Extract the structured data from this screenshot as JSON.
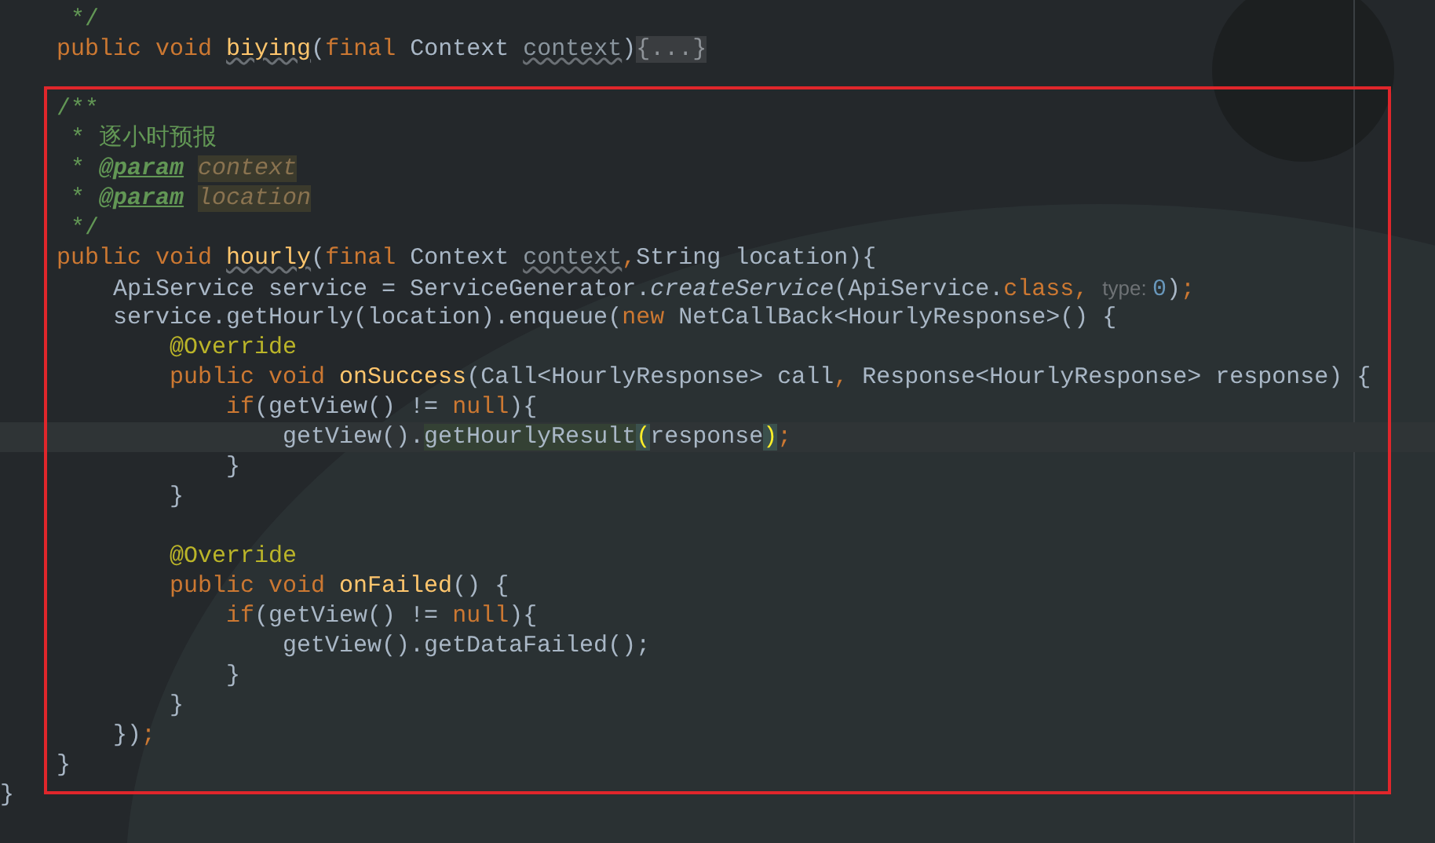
{
  "editor": {
    "lines": [
      {
        "tokens": [
          {
            "kind": "comment",
            "text": "     */"
          }
        ]
      },
      {
        "tokens": [
          {
            "kind": "keyword",
            "text": "    public void "
          },
          {
            "kind": "method",
            "text": "biying",
            "warn": true
          },
          {
            "kind": "plain",
            "text": "("
          },
          {
            "kind": "keyword",
            "text": "final "
          },
          {
            "kind": "plain",
            "text": "Context "
          },
          {
            "kind": "unused",
            "text": "context",
            "warn": true
          },
          {
            "kind": "plain",
            "text": ")"
          },
          {
            "kind": "fold",
            "text": "{...}"
          }
        ]
      },
      {
        "space_before": true,
        "tokens": [
          {
            "kind": "comment",
            "text": "    /**"
          }
        ]
      },
      {
        "tokens": [
          {
            "kind": "comment",
            "text": "     * 逐小时预报"
          }
        ]
      },
      {
        "tokens": [
          {
            "kind": "comment",
            "text": "     * "
          },
          {
            "kind": "doctag",
            "text": "@param "
          },
          {
            "kind": "docref",
            "text": "context"
          }
        ]
      },
      {
        "tokens": [
          {
            "kind": "comment",
            "text": "     * "
          },
          {
            "kind": "doctag",
            "text": "@param "
          },
          {
            "kind": "docref",
            "text": "location"
          }
        ]
      },
      {
        "tokens": [
          {
            "kind": "comment",
            "text": "     */"
          }
        ]
      },
      {
        "tokens": [
          {
            "kind": "keyword",
            "text": "    public void "
          },
          {
            "kind": "method",
            "text": "hourly",
            "warn": true
          },
          {
            "kind": "plain",
            "text": "("
          },
          {
            "kind": "keyword",
            "text": "final "
          },
          {
            "kind": "plain",
            "text": "Context "
          },
          {
            "kind": "unused",
            "text": "context",
            "warn": true
          },
          {
            "kind": "keyword",
            "text": ","
          },
          {
            "kind": "plain",
            "text": "String location){"
          }
        ]
      },
      {
        "tokens": [
          {
            "kind": "plain",
            "text": "        ApiService service = ServiceGenerator."
          },
          {
            "kind": "static",
            "text": "createService"
          },
          {
            "kind": "plain",
            "text": "(ApiService."
          },
          {
            "kind": "keyword",
            "text": "class, "
          },
          {
            "kind": "hint",
            "text": "type: "
          },
          {
            "kind": "number",
            "text": "0"
          },
          {
            "kind": "plain",
            "text": ")"
          },
          {
            "kind": "keyword",
            "text": ";"
          }
        ]
      },
      {
        "tokens": [
          {
            "kind": "plain",
            "text": "        service.getHourly(location).enqueue("
          },
          {
            "kind": "keyword",
            "text": "new "
          },
          {
            "kind": "plain",
            "text": "NetCallBack<HourlyResponse>() {"
          }
        ]
      },
      {
        "tokens": [
          {
            "kind": "annotation",
            "text": "            @Override"
          }
        ]
      },
      {
        "tokens": [
          {
            "kind": "keyword",
            "text": "            public void "
          },
          {
            "kind": "method",
            "text": "onSuccess"
          },
          {
            "kind": "plain",
            "text": "(Call<HourlyResponse> call"
          },
          {
            "kind": "keyword",
            "text": ", "
          },
          {
            "kind": "plain",
            "text": "Response<HourlyResponse> response) {"
          }
        ]
      },
      {
        "tokens": [
          {
            "kind": "keyword",
            "text": "                if"
          },
          {
            "kind": "plain",
            "text": "(getView() != "
          },
          {
            "kind": "keyword",
            "text": "null"
          },
          {
            "kind": "plain",
            "text": "){"
          }
        ]
      },
      {
        "current": true,
        "tokens": [
          {
            "kind": "plain",
            "text": "                    getView()."
          },
          {
            "kind": "usage",
            "text": "getHourlyResult"
          },
          {
            "kind": "brace",
            "text": "("
          },
          {
            "kind": "plain",
            "text": "response"
          },
          {
            "kind": "brace",
            "text": ")"
          },
          {
            "kind": "keyword",
            "text": ";"
          }
        ]
      },
      {
        "tokens": [
          {
            "kind": "plain",
            "text": "                }"
          }
        ]
      },
      {
        "tokens": [
          {
            "kind": "plain",
            "text": "            }"
          }
        ]
      },
      {
        "space_before": true,
        "tokens": [
          {
            "kind": "annotation",
            "text": "            @Override"
          }
        ]
      },
      {
        "tokens": [
          {
            "kind": "keyword",
            "text": "            public void "
          },
          {
            "kind": "method",
            "text": "onFailed"
          },
          {
            "kind": "plain",
            "text": "() {"
          }
        ]
      },
      {
        "tokens": [
          {
            "kind": "keyword",
            "text": "                if"
          },
          {
            "kind": "plain",
            "text": "(getView() != "
          },
          {
            "kind": "keyword",
            "text": "null"
          },
          {
            "kind": "plain",
            "text": "){"
          }
        ]
      },
      {
        "tokens": [
          {
            "kind": "plain",
            "text": "                    getView().getDataFailed();"
          }
        ]
      },
      {
        "tokens": [
          {
            "kind": "plain",
            "text": "                }"
          }
        ]
      },
      {
        "tokens": [
          {
            "kind": "plain",
            "text": "            }"
          }
        ]
      },
      {
        "tokens": [
          {
            "kind": "plain",
            "text": "        })"
          },
          {
            "kind": "keyword",
            "text": ";"
          }
        ]
      },
      {
        "tokens": [
          {
            "kind": "plain",
            "text": "    }"
          }
        ]
      },
      {
        "tokens": [
          {
            "kind": "plain",
            "text": "}"
          }
        ]
      }
    ]
  }
}
